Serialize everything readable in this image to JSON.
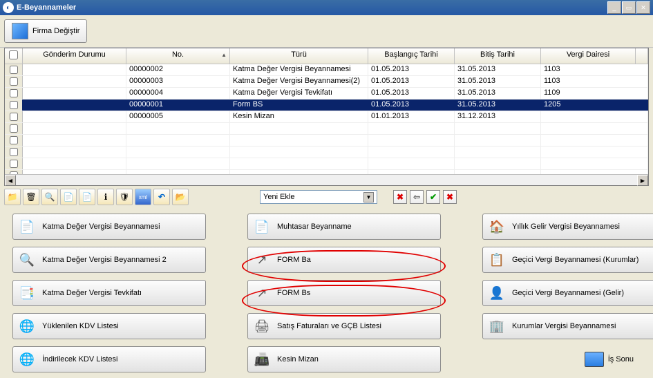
{
  "window": {
    "title": "E-Beyannameler"
  },
  "toolbar": {
    "change_firm": "Firma Değiştir"
  },
  "grid": {
    "headers": {
      "gonderim": "Gönderim Durumu",
      "no": "No.",
      "turu": "Türü",
      "baslangic": "Başlangıç Tarihi",
      "bitis": "Bitiş Tarihi",
      "vergi": "Vergi Dairesi"
    },
    "rows": [
      {
        "no": "00000002",
        "turu": "Katma Değer Vergisi Beyannamesi",
        "start": "01.05.2013",
        "end": "31.05.2013",
        "vd": "1103",
        "selected": false
      },
      {
        "no": "00000003",
        "turu": "Katma Değer Vergisi Beyannamesi(2)",
        "start": "01.05.2013",
        "end": "31.05.2013",
        "vd": "1103",
        "selected": false
      },
      {
        "no": "00000004",
        "turu": "Katma Değer Vergisi Tevkifatı",
        "start": "01.05.2013",
        "end": "31.05.2013",
        "vd": "1109",
        "selected": false
      },
      {
        "no": "00000001",
        "turu": "Form BS",
        "start": "01.05.2013",
        "end": "31.05.2013",
        "vd": "1205",
        "selected": true
      },
      {
        "no": "00000005",
        "turu": "Kesin Mizan",
        "start": "01.01.2013",
        "end": "31.12.2013",
        "vd": "",
        "selected": false
      }
    ]
  },
  "dropdown": {
    "value": "Yeni Ekle"
  },
  "icons": {
    "folder": "📁",
    "trash": "🗑",
    "zoom": "🔍",
    "doc1": "📄",
    "doc2": "📄",
    "info": "ℹ",
    "shield": "🛡",
    "xml": "xml",
    "undo": "↶",
    "open": "📂",
    "xr": "✖",
    "back": "⇦",
    "ok": "✔",
    "xx": "✖"
  },
  "buttons": {
    "col1": [
      {
        "label": "Katma Değer Vergisi Beyannamesi",
        "icon": "📄"
      },
      {
        "label": "Katma Değer Vergisi Beyannamesi 2",
        "icon": "🔍"
      },
      {
        "label": "Katma Değer Vergisi Tevkifatı",
        "icon": "📑"
      },
      {
        "label": "Yüklenilen KDV Listesi",
        "icon": "🌐"
      },
      {
        "label": "İndirilecek KDV Listesi",
        "icon": "🌐"
      }
    ],
    "col2": [
      {
        "label": "Muhtasar Beyanname",
        "icon": "📄"
      },
      {
        "label": "FORM Ba",
        "icon": "↗"
      },
      {
        "label": "FORM Bs",
        "icon": "↗"
      },
      {
        "label": "Satış Faturaları ve GÇB Listesi",
        "icon": "🖨"
      },
      {
        "label": "Kesin Mizan",
        "icon": "📠"
      }
    ],
    "col3": [
      {
        "label": "Yıllık Gelir Vergisi Beyannamesi",
        "icon": "🏠"
      },
      {
        "label": "Geçici Vergi Beyannamesi (Kurumlar)",
        "icon": "📋"
      },
      {
        "label": "Geçici Vergi Beyannamesi (Gelir)",
        "icon": "👤"
      },
      {
        "label": "Kurumlar Vergisi Beyannamesi",
        "icon": "🏢"
      }
    ],
    "end": "İş Sonu"
  }
}
